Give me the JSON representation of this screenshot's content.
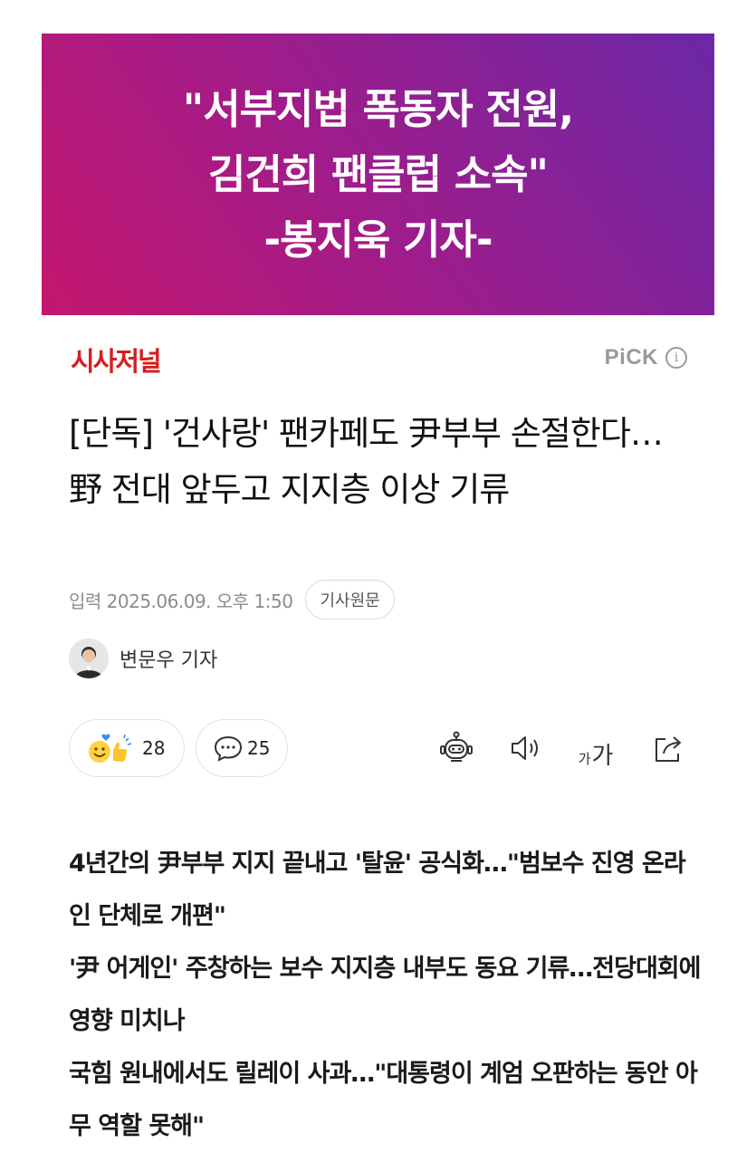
{
  "banner": {
    "lines": [
      "\"서부지법 폭동자 전원,",
      "김건희 팬클럽 소속\"",
      "-봉지욱 기자-"
    ]
  },
  "publisher": {
    "name": "시사저널"
  },
  "pick": {
    "label": "PiCK",
    "info_glyph": "i"
  },
  "article": {
    "headline": "[단독] '건사랑' 팬카페도 尹부부 손절한다…野 전대 앞두고 지지층 이상 기류",
    "date": "입력 2025.06.09. 오후 1:50",
    "original_button": "기사원문",
    "reporter": "변문우 기자"
  },
  "actions": {
    "reaction_count": "28",
    "comment_count": "25",
    "fontsize_small": "가",
    "fontsize_big": "가",
    "icons": [
      "reaction-emoji-icon",
      "comment-bubble-icon",
      "robot-summary-icon",
      "speaker-icon",
      "share-icon"
    ]
  },
  "summary": [
    "4년간의 尹부부 지지 끝내고 '탈윤' 공식화…\"범보수 진영 온라인 단체로 개편\"",
    "'尹 어게인' 주창하는 보수 지지층 내부도 동요 기류…전당대회에 영향 미치나",
    "국힘 원내에서도 릴레이 사과…\"대통령이 계엄 오판하는 동안 아무 역할 못해\""
  ],
  "colors": {
    "banner_start": "#c4176e",
    "banner_end": "#6b28a6",
    "publisher_red": "#d61f1f",
    "muted_gray": "#8c8c8c"
  }
}
